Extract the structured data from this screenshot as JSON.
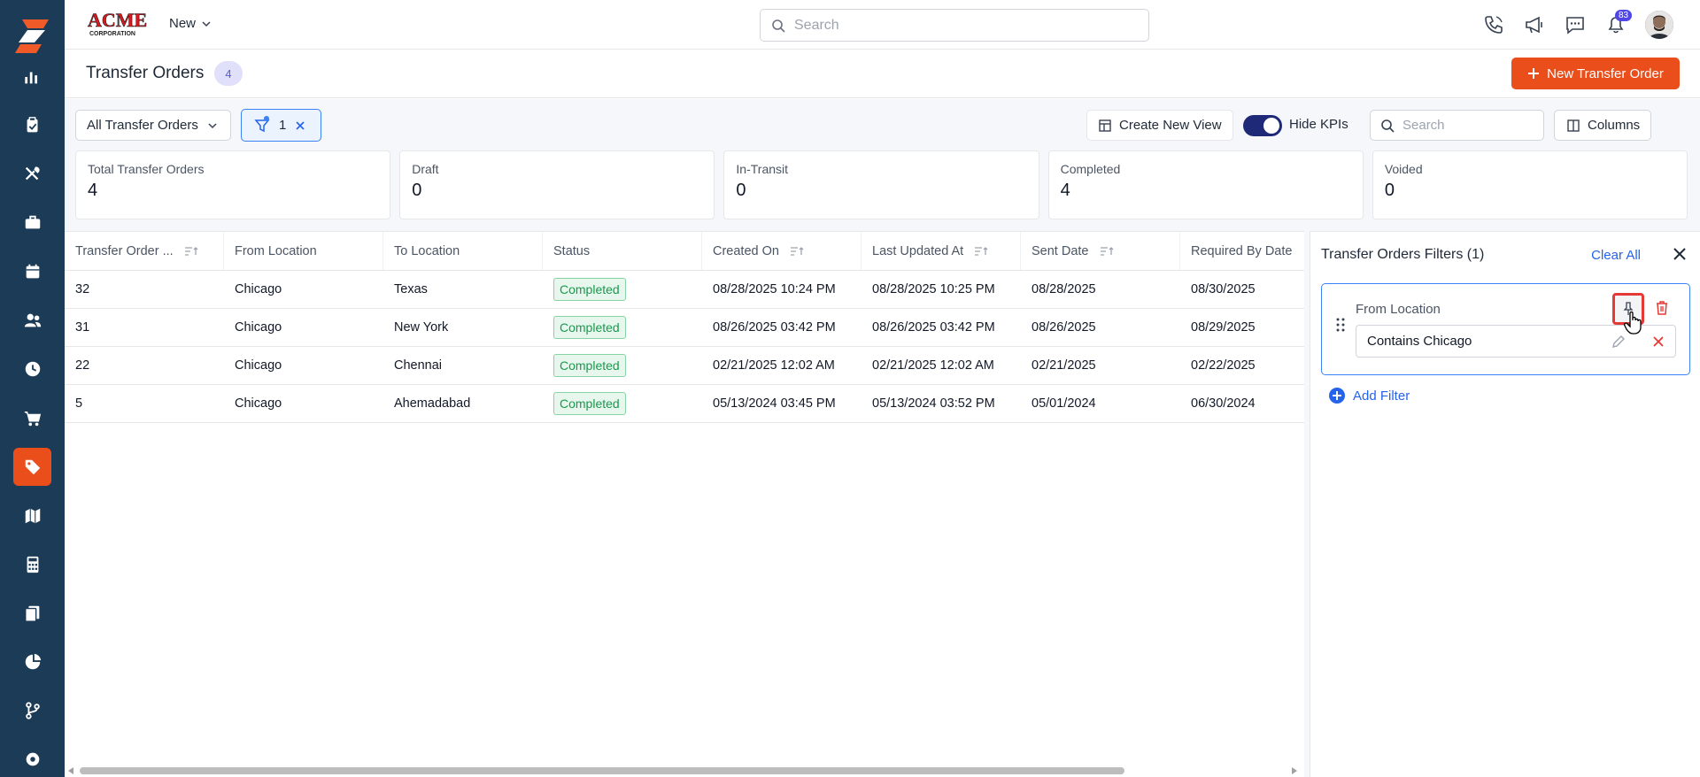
{
  "app": {
    "brand": "ACME",
    "brand_sub": "CORPORATION",
    "new_menu_label": "New",
    "search_placeholder": "Search",
    "notification_count": "83"
  },
  "sidebar": {
    "items": [
      {
        "icon": "chart-icon"
      },
      {
        "icon": "clipboard-icon"
      },
      {
        "icon": "tools-icon"
      },
      {
        "icon": "briefcase-icon"
      },
      {
        "icon": "calendar-icon"
      },
      {
        "icon": "users-icon"
      },
      {
        "icon": "clock-icon"
      },
      {
        "icon": "cart-icon"
      },
      {
        "icon": "tag-icon",
        "active": true
      },
      {
        "icon": "map-icon"
      },
      {
        "icon": "calculator-icon"
      },
      {
        "icon": "documents-icon"
      },
      {
        "icon": "pie-chart-icon"
      },
      {
        "icon": "branch-icon"
      },
      {
        "icon": "settings-icon"
      }
    ]
  },
  "page": {
    "title": "Transfer Orders",
    "count": "4",
    "new_button_label": "New Transfer Order"
  },
  "toolbar": {
    "view_label": "All Transfer Orders",
    "filter_count": "1",
    "create_view_label": "Create New View",
    "hide_kpis_label": "Hide KPIs",
    "hide_kpis_on": true,
    "search_placeholder": "Search",
    "columns_label": "Columns"
  },
  "kpis": [
    {
      "label": "Total Transfer Orders",
      "value": "4"
    },
    {
      "label": "Draft",
      "value": "0"
    },
    {
      "label": "In-Transit",
      "value": "0"
    },
    {
      "label": "Completed",
      "value": "4"
    },
    {
      "label": "Voided",
      "value": "0"
    }
  ],
  "table": {
    "columns": [
      "Transfer Order ...",
      "From Location",
      "To Location",
      "Status",
      "Created On",
      "Last Updated At",
      "Sent Date",
      "Required By Date"
    ],
    "rows": [
      [
        "32",
        "Chicago",
        "Texas",
        "Completed",
        "08/28/2025 10:24 PM",
        "08/28/2025 10:25 PM",
        "08/28/2025",
        "08/30/2025"
      ],
      [
        "31",
        "Chicago",
        "New York",
        "Completed",
        "08/26/2025 03:42 PM",
        "08/26/2025 03:42 PM",
        "08/26/2025",
        "08/29/2025"
      ],
      [
        "22",
        "Chicago",
        "Chennai",
        "Completed",
        "02/21/2025 12:02 AM",
        "02/21/2025 12:02 AM",
        "02/21/2025",
        "02/22/2025"
      ],
      [
        "5",
        "Chicago",
        "Ahemadabad",
        "Completed",
        "05/13/2024 03:45 PM",
        "05/13/2024 03:52 PM",
        "05/01/2024",
        "06/30/2024"
      ]
    ]
  },
  "filters_panel": {
    "title": "Transfer Orders Filters (1)",
    "clear_all_label": "Clear All",
    "filter_field": "From Location",
    "filter_value": "Contains Chicago",
    "add_filter_label": "Add Filter"
  },
  "colors": {
    "sidebar": "#1c3b57",
    "accent": "#e94e1b",
    "link": "#2563eb",
    "success": "#19994d"
  }
}
